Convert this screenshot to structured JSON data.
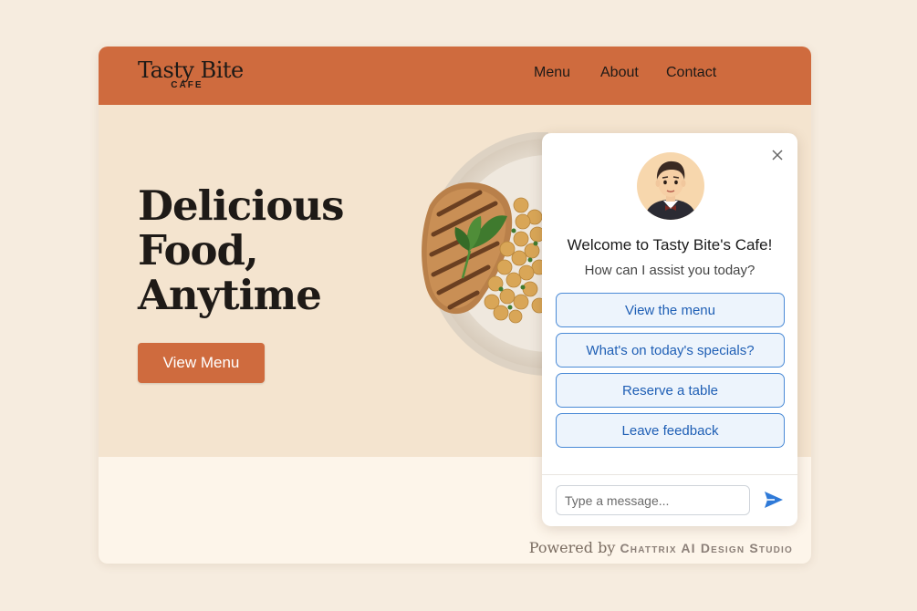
{
  "header": {
    "brand_name": "Tasty Bite",
    "brand_sub": "CAFE",
    "nav": [
      "Menu",
      "About",
      "Contact"
    ]
  },
  "hero": {
    "title_lines": [
      "Delicious",
      "Food,",
      "Anytime"
    ],
    "cta_label": "View Menu",
    "image_icon": "plate-of-grilled-chicken-and-chickpeas-icon"
  },
  "chat": {
    "avatar_icon": "waiter-avatar-icon",
    "close_icon": "close-icon",
    "title": "Welcome to Tasty Bite's Cafe!",
    "subtitle": "How can I assist you today?",
    "options": [
      "View the menu",
      "What's on today's specials?",
      "Reserve a table",
      "Leave feedback"
    ],
    "input_placeholder": "Type a message...",
    "send_icon": "send-icon"
  },
  "footer": {
    "powered_prefix": "Powered by",
    "powered_brand": "Chattrix AI Design Studio"
  },
  "colors": {
    "accent": "#cf6b3e",
    "page_bg": "#f6ecdf",
    "hero_bg": "#f4e4cf",
    "option_border": "#4a8ad6",
    "option_text": "#1f5fb5"
  }
}
